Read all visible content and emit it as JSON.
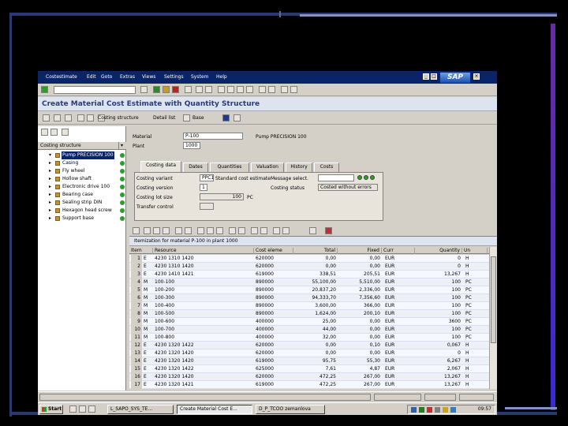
{
  "menubar": {
    "items": [
      "Costestimate",
      "Edit",
      "Goto",
      "Extras",
      "Views",
      "Settings",
      "System",
      "Help"
    ],
    "logo": "SAP"
  },
  "title": "Create Material Cost Estimate with Quantity Structure",
  "app_toolbar": {
    "btn1": "Costing structure",
    "btn2": "Detail list",
    "btn3": "Base"
  },
  "left_pane": {
    "header": "Costing structure",
    "items": [
      {
        "label": "Pump PRECISION 100",
        "selected": true
      },
      {
        "label": "Casing",
        "selected": false
      },
      {
        "label": "Fly wheel",
        "selected": false
      },
      {
        "label": "Hollow shaft",
        "selected": false
      },
      {
        "label": "Electronic drive 100",
        "selected": false
      },
      {
        "label": "Bearing case",
        "selected": false
      },
      {
        "label": "Sealing strip DIN",
        "selected": false
      },
      {
        "label": "Hexagon head screw",
        "selected": false
      },
      {
        "label": "Support base",
        "selected": false
      }
    ]
  },
  "header": {
    "material_label": "Material",
    "material_value": "P-100",
    "material_desc": "Pump PRECISION 100",
    "plant_label": "Plant",
    "plant_value": "1000",
    "tabs": [
      "Costing data",
      "Dates",
      "Quantities",
      "Valuation",
      "History",
      "Costs"
    ],
    "fields": {
      "variant_label": "Costing variant",
      "variant_value": "PPC1",
      "variant_desc": "Standard cost estimate",
      "message_label": "Message select.",
      "message_value": "",
      "version_label": "Costing version",
      "version_value": "1",
      "status_label": "Costing status",
      "status_value": "Costed without errors",
      "lot_label": "Costing lot size",
      "lot_value": "100",
      "lot_unit": "PC",
      "transfer_label": "Transfer control",
      "transfer_value": ""
    }
  },
  "grid": {
    "title": "Itemization for material P-100 in plant 1000",
    "columns": [
      "Item",
      "Resource",
      "Cost eleme",
      "Total",
      "Fixed",
      "Curr",
      "Quantity",
      "Un"
    ],
    "rows": [
      {
        "item": "1",
        "cat": "E",
        "resource": "4230  1310  1420",
        "cost_el": "620000",
        "total": "0,00",
        "fixed": "0,00",
        "curr": "EUR",
        "qty": "0",
        "un": "H"
      },
      {
        "item": "2",
        "cat": "E",
        "resource": "4230  1310  1420",
        "cost_el": "620000",
        "total": "0,00",
        "fixed": "0,00",
        "curr": "EUR",
        "qty": "0",
        "un": "H"
      },
      {
        "item": "3",
        "cat": "E",
        "resource": "4230  1410  1421",
        "cost_el": "619000",
        "total": "338,51",
        "fixed": "205,51",
        "curr": "EUR",
        "qty": "13,267",
        "un": "H"
      },
      {
        "item": "4",
        "cat": "M",
        "resource": "100-100",
        "cost_el": "890000",
        "total": "55,100,00",
        "fixed": "5,510,00",
        "curr": "EUR",
        "qty": "100",
        "un": "PC"
      },
      {
        "item": "5",
        "cat": "M",
        "resource": "100-200",
        "cost_el": "890000",
        "total": "20,837,20",
        "fixed": "2,336,00",
        "curr": "EUR",
        "qty": "100",
        "un": "PC"
      },
      {
        "item": "6",
        "cat": "M",
        "resource": "100-300",
        "cost_el": "890000",
        "total": "94,333,70",
        "fixed": "7,356,60",
        "curr": "EUR",
        "qty": "100",
        "un": "PC"
      },
      {
        "item": "7",
        "cat": "M",
        "resource": "100-400",
        "cost_el": "890000",
        "total": "3,600,00",
        "fixed": "366,00",
        "curr": "EUR",
        "qty": "100",
        "un": "PC"
      },
      {
        "item": "8",
        "cat": "M",
        "resource": "100-500",
        "cost_el": "890000",
        "total": "1,624,00",
        "fixed": "200,10",
        "curr": "EUR",
        "qty": "100",
        "un": "PC"
      },
      {
        "item": "9",
        "cat": "M",
        "resource": "100-600",
        "cost_el": "400000",
        "total": "25,00",
        "fixed": "0,00",
        "curr": "EUR",
        "qty": "3600",
        "un": "PC"
      },
      {
        "item": "10",
        "cat": "M",
        "resource": "100-700",
        "cost_el": "400000",
        "total": "44,00",
        "fixed": "0,00",
        "curr": "EUR",
        "qty": "100",
        "un": "PC"
      },
      {
        "item": "11",
        "cat": "M",
        "resource": "100-800",
        "cost_el": "400000",
        "total": "32,00",
        "fixed": "0,00",
        "curr": "EUR",
        "qty": "100",
        "un": "PC"
      },
      {
        "item": "12",
        "cat": "E",
        "resource": "4230  1320  1422",
        "cost_el": "620000",
        "total": "0,00",
        "fixed": "0,10",
        "curr": "EUR",
        "qty": "0,067",
        "un": "H"
      },
      {
        "item": "13",
        "cat": "E",
        "resource": "4230  1320  1420",
        "cost_el": "620000",
        "total": "0,00",
        "fixed": "0,00",
        "curr": "EUR",
        "qty": "0",
        "un": "H"
      },
      {
        "item": "14",
        "cat": "E",
        "resource": "4230  1320  1420",
        "cost_el": "619000",
        "total": "95,75",
        "fixed": "55,30",
        "curr": "EUR",
        "qty": "6,267",
        "un": "H"
      },
      {
        "item": "15",
        "cat": "E",
        "resource": "4230  1320  1422",
        "cost_el": "625000",
        "total": "7,61",
        "fixed": "4,87",
        "curr": "EUR",
        "qty": "2,067",
        "un": "H"
      },
      {
        "item": "16",
        "cat": "E",
        "resource": "4230  1320  1420",
        "cost_el": "620000",
        "total": "472,25",
        "fixed": "267,00",
        "curr": "EUR",
        "qty": "13,267",
        "un": "H"
      },
      {
        "item": "17",
        "cat": "E",
        "resource": "4230  1320  1421",
        "cost_el": "619000",
        "total": "472,25",
        "fixed": "267,00",
        "curr": "EUR",
        "qty": "13,267",
        "un": "H"
      }
    ]
  },
  "taskbar": {
    "start": "Start",
    "tasks": [
      "",
      "L_SAPO_SYS_TE...",
      "Create Material Cost E...",
      "D_P_TCOO zemanlova"
    ],
    "active_index": 2,
    "clock": "09:57"
  },
  "colors": {
    "sap_title": "#2a3a7a",
    "selection": "#0a246a",
    "status_green": "#2aa02a"
  }
}
